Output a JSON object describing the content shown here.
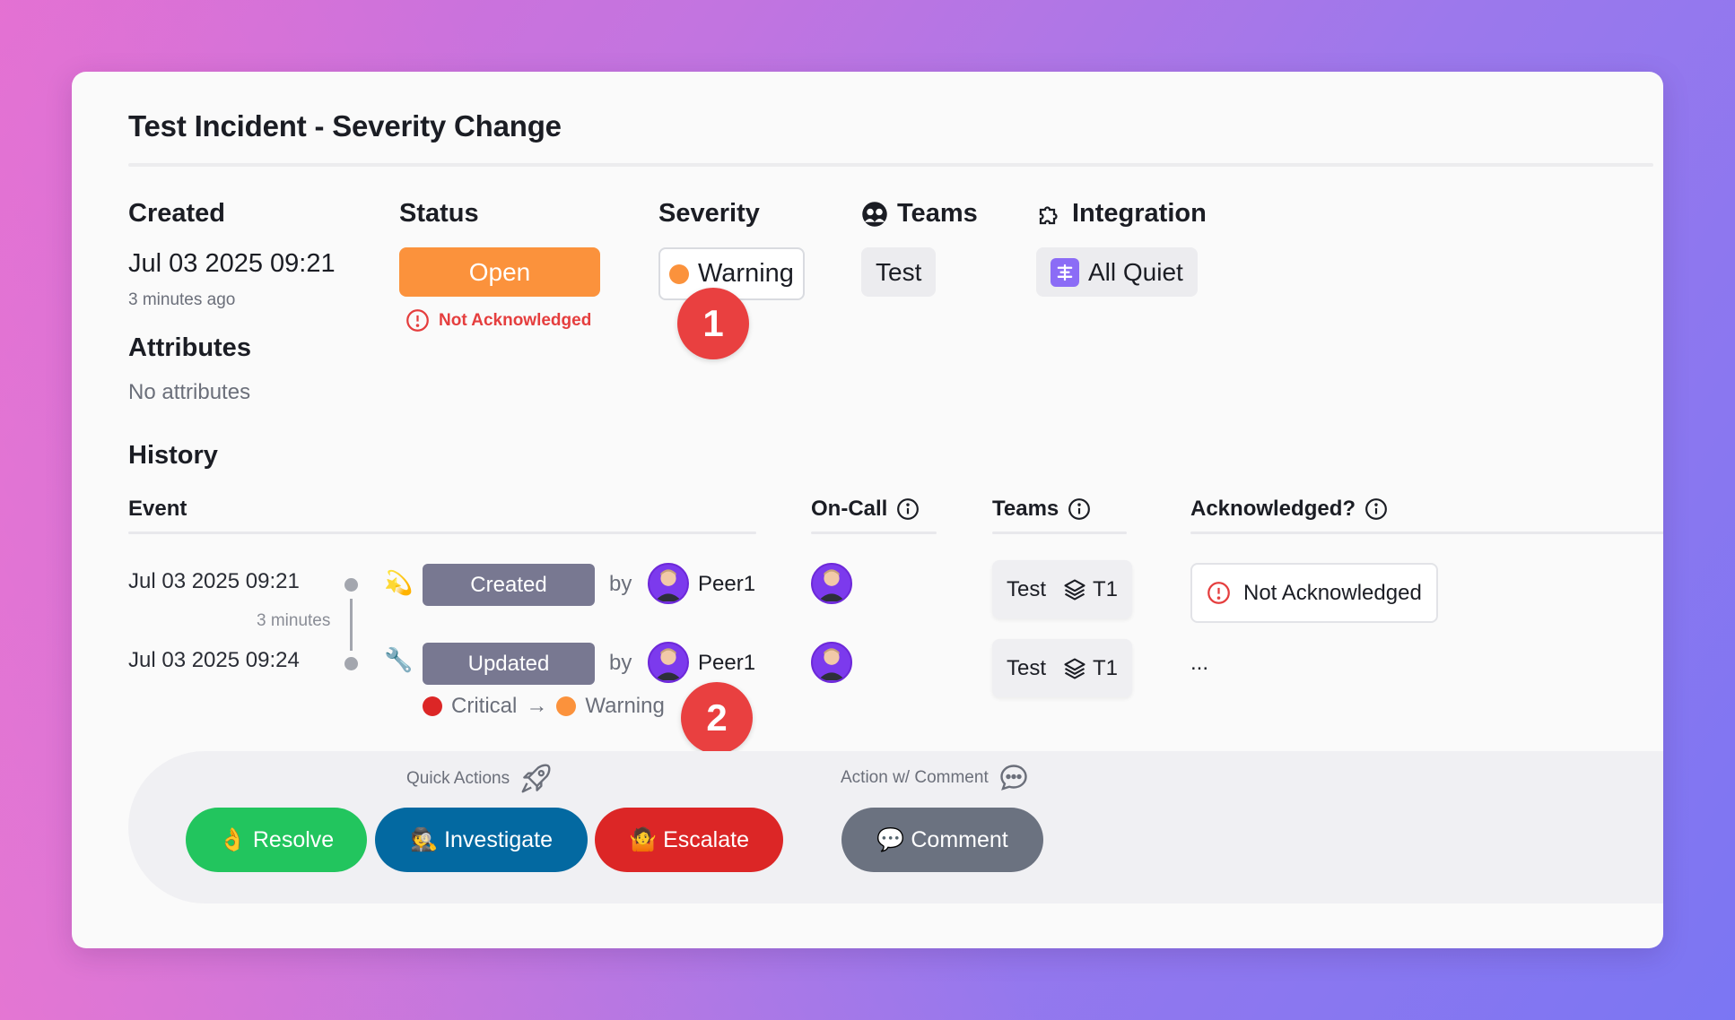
{
  "incident": {
    "title": "Test Incident - Severity Change"
  },
  "details": {
    "created_label": "Created",
    "created_value": "Jul 03 2025 09:21",
    "created_relative": "3 minutes ago",
    "status_label": "Status",
    "status_value": "Open",
    "ack_status": "Not Acknowledged",
    "severity_label": "Severity",
    "severity_value": "Warning",
    "teams_label": "Teams",
    "teams_value": "Test",
    "integration_label": "Integration",
    "integration_value": "All Quiet",
    "attributes_label": "Attributes",
    "attributes_value": "No attributes"
  },
  "markers": [
    "1",
    "2"
  ],
  "history": {
    "title": "History",
    "columns": {
      "event": "Event",
      "oncall": "On-Call",
      "teams": "Teams",
      "acknowledged": "Acknowledged?"
    },
    "duration": "3 minutes",
    "rows": [
      {
        "time": "Jul 03 2025 09:21",
        "event": "Created",
        "by": "by",
        "user": "Peer1",
        "team": "Test",
        "tier": "T1",
        "ack": "Not Acknowledged"
      },
      {
        "time": "Jul 03 2025 09:24",
        "event": "Updated",
        "by": "by",
        "user": "Peer1",
        "team": "Test",
        "tier": "T1",
        "ack": "...",
        "change_from": "Critical",
        "change_arrow": "→",
        "change_to": "Warning"
      }
    ]
  },
  "actions": {
    "quick_actions_label": "Quick Actions",
    "comment_section_label": "Action w/ Comment",
    "resolve": "👌 Resolve",
    "investigate": "🕵️ Investigate",
    "escalate": "🤷 Escalate",
    "comment": "💬 Comment"
  },
  "colors": {
    "status_open": "#fb923c",
    "severity_warning": "#fb923c",
    "severity_critical": "#dc2626",
    "resolve": "#22c55e",
    "investigate": "#0369a1",
    "escalate": "#dc2626",
    "comment": "#6b7280",
    "event_badge": "#787891",
    "marker": "#e94040"
  }
}
